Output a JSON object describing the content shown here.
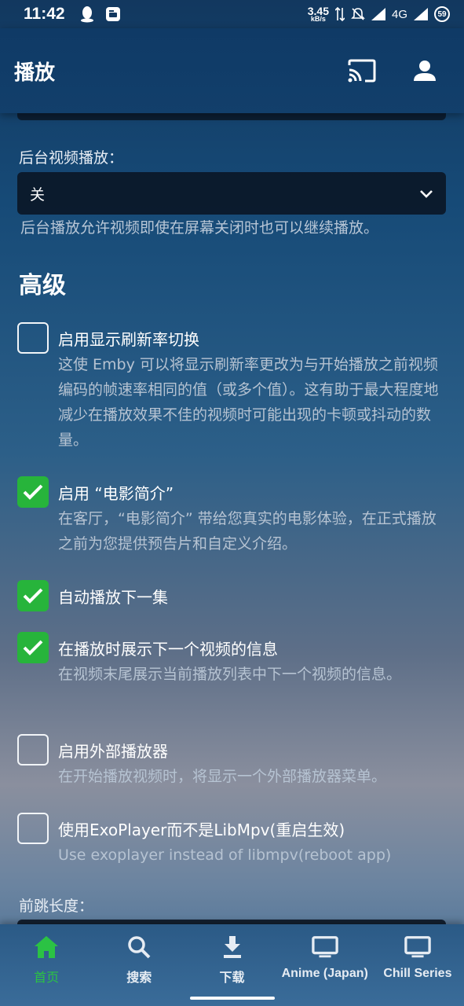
{
  "status_bar": {
    "time": "11:42",
    "speed_value": "3.45",
    "speed_unit": "kB/s",
    "network": "4G",
    "battery": "59"
  },
  "header": {
    "title": "播放",
    "cast_icon": "cast-icon",
    "user_icon": "user-icon"
  },
  "background_playback": {
    "label": "后台视频播放：",
    "value": "关",
    "help": "后台播放允许视频即使在屏幕关闭时也可以继续播放。"
  },
  "advanced": {
    "title": "高级",
    "options": [
      {
        "label": "启用显示刷新率切换",
        "checked": false,
        "description": "这使 Emby 可以将显示刷新率更改为与开始播放之前视频编码的帧速率相同的值（或多个值）。这有助于最大程度地减少在播放效果不佳的视频时可能出现的卡顿或抖动的数量。"
      },
      {
        "label": "启用 “电影简介”",
        "checked": true,
        "description": "在客厅，“电影简介” 带给您真实的电影体验，在正式播放之前为您提供预告片和自定义介绍。"
      },
      {
        "label": "自动播放下一集",
        "checked": true,
        "description": ""
      },
      {
        "label": "在播放时展示下一个视频的信息",
        "checked": true,
        "description": "在视频末尾展示当前播放列表中下一个视频的信息。"
      },
      {
        "label": "启用外部播放器",
        "checked": false,
        "description": "在开始播放视频时，将显示一个外部播放器菜单。"
      },
      {
        "label": "使用ExoPlayer而不是LibMpv(重启生效)",
        "checked": false,
        "description": "Use exoplayer instead of libmpv(reboot app)"
      }
    ]
  },
  "skip_forward": {
    "label": "前跳长度："
  },
  "bottom_nav": {
    "items": [
      {
        "label": "首页",
        "icon": "home-icon",
        "active": true
      },
      {
        "label": "搜索",
        "icon": "search-icon",
        "active": false
      },
      {
        "label": "下载",
        "icon": "download-icon",
        "active": false
      },
      {
        "label": "Anime (Japan)",
        "icon": "tv-icon",
        "active": false
      },
      {
        "label": "Chill Series",
        "icon": "tv-icon",
        "active": false
      }
    ]
  },
  "colors": {
    "accent_green": "#27b43b",
    "header_bg": "#0f3a66"
  }
}
